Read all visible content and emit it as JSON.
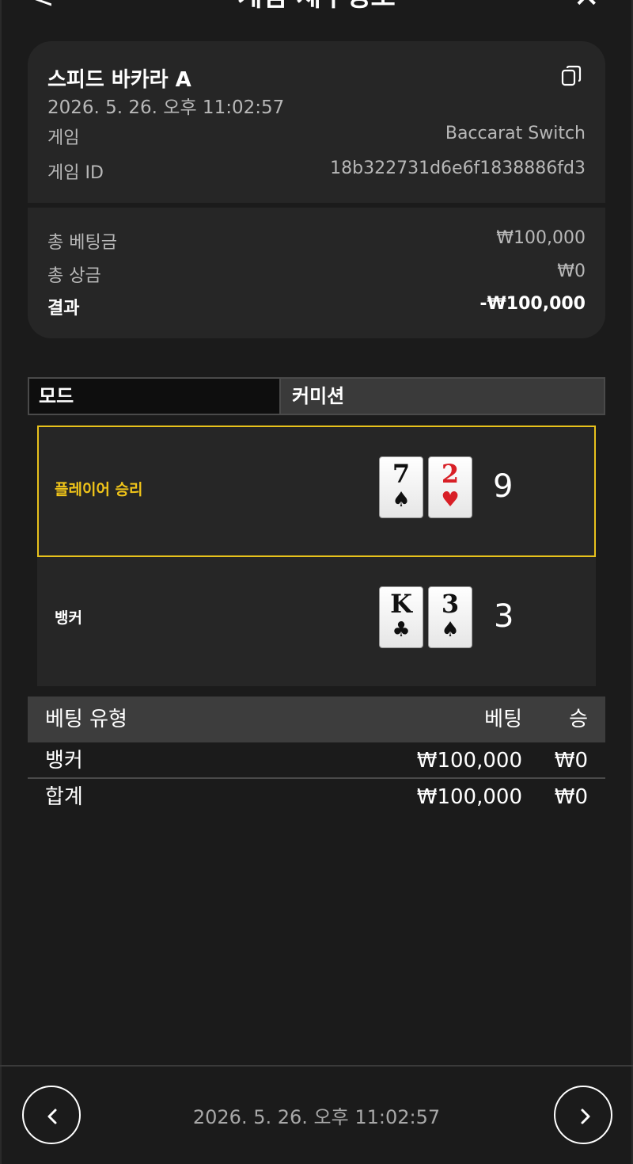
{
  "header": {
    "title": "게임 세부정보"
  },
  "round": {
    "game_name": "스피드 바카라 A",
    "datetime": "2026. 5. 26. 오후 11:02:57",
    "game_label": "게임",
    "game_value": "Baccarat Switch",
    "id_label": "게임 ID",
    "id_value": "18b322731d6e6f1838886fd3"
  },
  "totals": {
    "bet_label": "총 베팅금",
    "bet_value": "₩100,000",
    "win_label": "총 상금",
    "win_value": "₩0",
    "result_label": "결과",
    "result_value": "-₩100,000"
  },
  "mode": {
    "label": "모드",
    "value": "커미션"
  },
  "player": {
    "label": "플레이어 승리",
    "cards": [
      {
        "rank": "7",
        "suit": "♠",
        "color": "#111111"
      },
      {
        "rank": "2",
        "suit": "♥",
        "color": "#d81f26"
      }
    ],
    "score": "9"
  },
  "banker": {
    "label": "뱅커",
    "cards": [
      {
        "rank": "K",
        "suit": "♣",
        "color": "#111111"
      },
      {
        "rank": "3",
        "suit": "♠",
        "color": "#111111"
      }
    ],
    "score": "3"
  },
  "bet_table": {
    "headers": {
      "type": "베팅 유형",
      "bet": "베팅",
      "win": "승"
    },
    "rows": [
      {
        "type": "뱅커",
        "bet": "₩100,000",
        "win": "₩0"
      },
      {
        "type": "합계",
        "bet": "₩100,000",
        "win": "₩0"
      }
    ]
  },
  "footer": {
    "datetime": "2026. 5. 26. 오후 11:02:57"
  },
  "colors": {
    "background": "#1b1b1b",
    "card_bg": "#262626",
    "accent_gold": "#e8c21c"
  }
}
